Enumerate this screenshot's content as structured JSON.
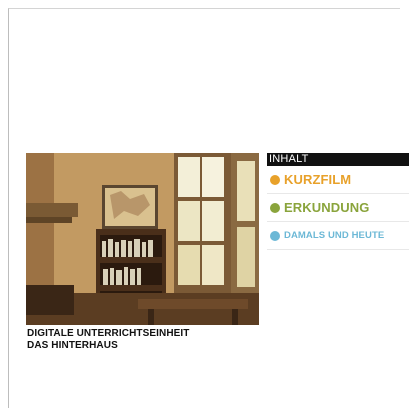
{
  "hero": {
    "caption_line1": "DIGITALE UNTERRICHTSEINHEIT",
    "caption_line2": "DAS HINTERHAUS"
  },
  "menu": {
    "header": "INHALT",
    "items": [
      {
        "label": "KURZFILM",
        "color": "#e8a12a"
      },
      {
        "label": "ERKUNDUNG",
        "color": "#8aa43c"
      },
      {
        "label": "DAMALS UND HEUTE",
        "color": "#6cb8d6"
      }
    ]
  }
}
